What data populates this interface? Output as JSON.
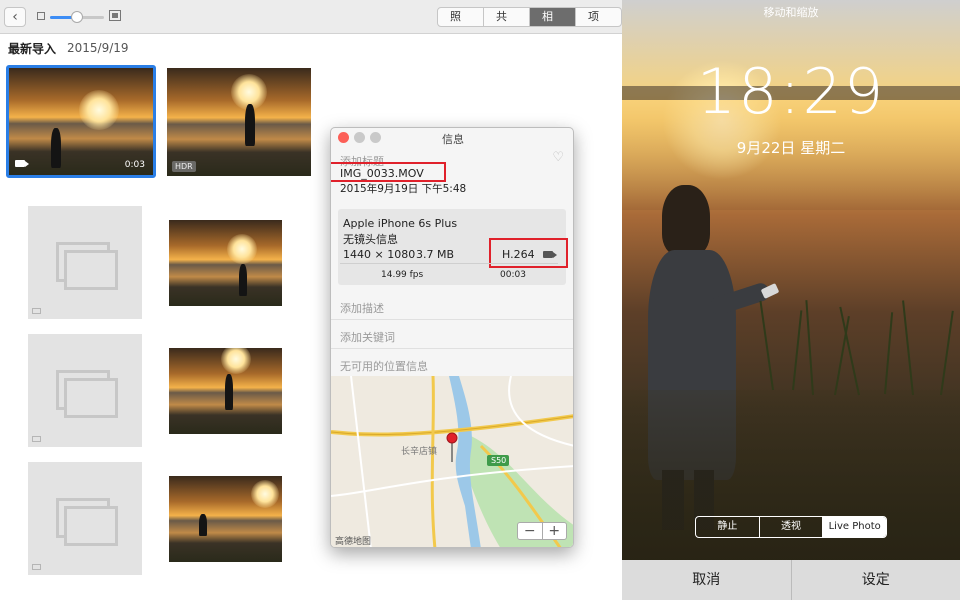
{
  "toolbar": {
    "back_icon": "chevron-left-icon",
    "zoom_level": 0.5,
    "tabs": [
      {
        "label": "照片",
        "active": false
      },
      {
        "label": "共享",
        "active": false
      },
      {
        "label": "相簿",
        "active": true
      },
      {
        "label": "项目",
        "active": false
      }
    ]
  },
  "album": {
    "title": "最新导入",
    "date": "2015/9/19",
    "first_item": {
      "duration": "0:03",
      "selected": true
    },
    "second_item": {
      "badge": "HDR"
    }
  },
  "info_panel": {
    "window_title": "信息",
    "add_title_placeholder": "添加标题",
    "filename": "IMG_0033.MOV",
    "datetime": "2015年9月19日   下午5:48",
    "camera": "Apple iPhone 6s Plus",
    "lens": "无镜头信息",
    "resolution": "1440 × 1080",
    "file_size": "3.7 MB",
    "codec": "H.264",
    "fps": "14.99 fps",
    "duration": "00:03",
    "add_description": "添加描述",
    "add_keywords": "添加关键词",
    "location": "无可用的位置信息",
    "map": {
      "place_label": "长辛店镇",
      "road_label": "S50",
      "watermark": "高德地图",
      "zoom_out": "−",
      "zoom_in": "+"
    }
  },
  "lock_screen": {
    "hint": "移动和缩放",
    "time": "18:29",
    "date": "9月22日 星期二",
    "modes": [
      {
        "label": "静止",
        "active": false
      },
      {
        "label": "透视",
        "active": false
      },
      {
        "label": "Live Photo",
        "active": true
      }
    ],
    "cancel": "取消",
    "set": "设定"
  },
  "colors": {
    "accent": "#2a7ee6",
    "highlight_box": "#e0212b",
    "map_pin": "#e0212b",
    "map_road": "#f2c94c",
    "map_water": "#9cc8e8"
  }
}
